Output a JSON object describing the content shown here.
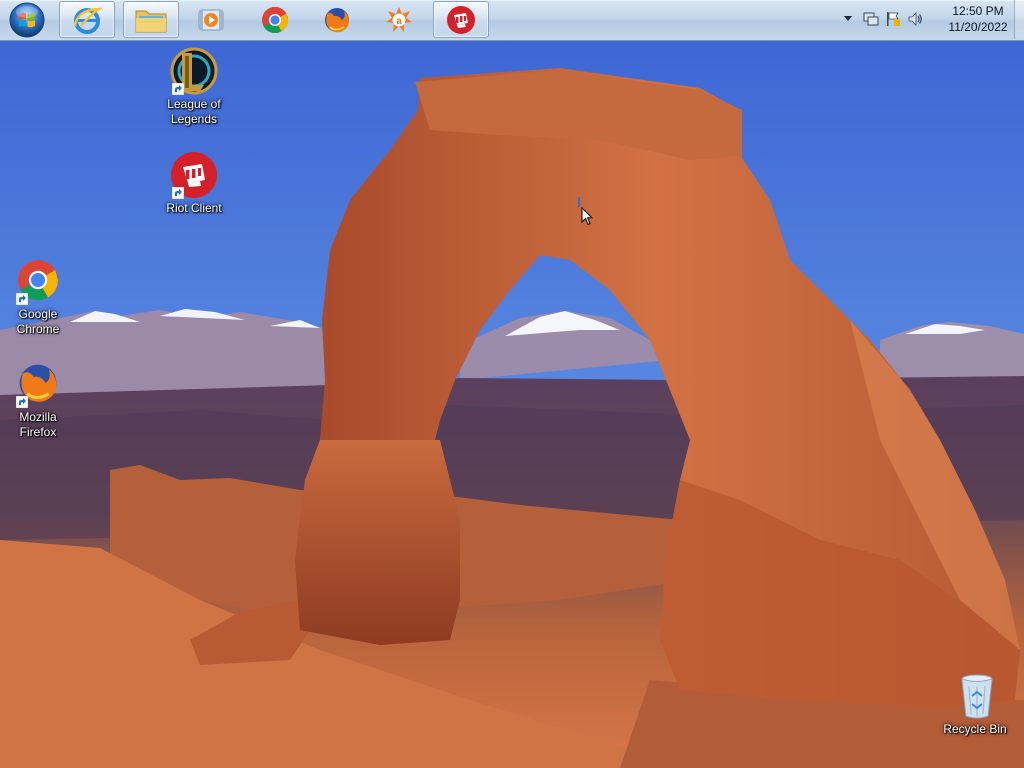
{
  "taskbar": {
    "start_button": "windows-orb-icon",
    "pinned": [
      {
        "name": "internet-explorer",
        "icon": "internet-explorer-icon"
      },
      {
        "name": "windows-explorer",
        "icon": "folder-icon"
      },
      {
        "name": "media-player",
        "icon": "media-player-icon"
      },
      {
        "name": "google-chrome",
        "icon": "chrome-icon"
      },
      {
        "name": "mozilla-firefox",
        "icon": "firefox-icon"
      },
      {
        "name": "avast",
        "icon": "avast-icon"
      },
      {
        "name": "riot-client",
        "icon": "riot-client-icon"
      }
    ]
  },
  "tray": {
    "icons": [
      "show-hidden-icons-chevron-icon",
      "network-icon",
      "action-center-flag-icon",
      "volume-icon"
    ],
    "time": "12:50 PM",
    "date": "11/20/2022"
  },
  "desktop": {
    "icons": [
      {
        "label_lines": [
          "League of",
          "Legends"
        ],
        "icon": "league-of-legends-icon",
        "shortcut": true
      },
      {
        "label_lines": [
          "Riot Client"
        ],
        "icon": "riot-client-icon",
        "shortcut": true
      },
      {
        "label_lines": [
          "Google",
          "Chrome"
        ],
        "icon": "chrome-icon",
        "shortcut": true
      },
      {
        "label_lines": [
          "Mozilla",
          "Firefox"
        ],
        "icon": "firefox-icon",
        "shortcut": true
      },
      {
        "label_lines": [
          "Recycle Bin"
        ],
        "icon": "recycle-bin-icon",
        "shortcut": false
      }
    ]
  },
  "colors": {
    "taskbar": "#c3d6ea",
    "sky": "#4a78d6",
    "rock": "#c0623a",
    "riot_red": "#d5202a"
  }
}
